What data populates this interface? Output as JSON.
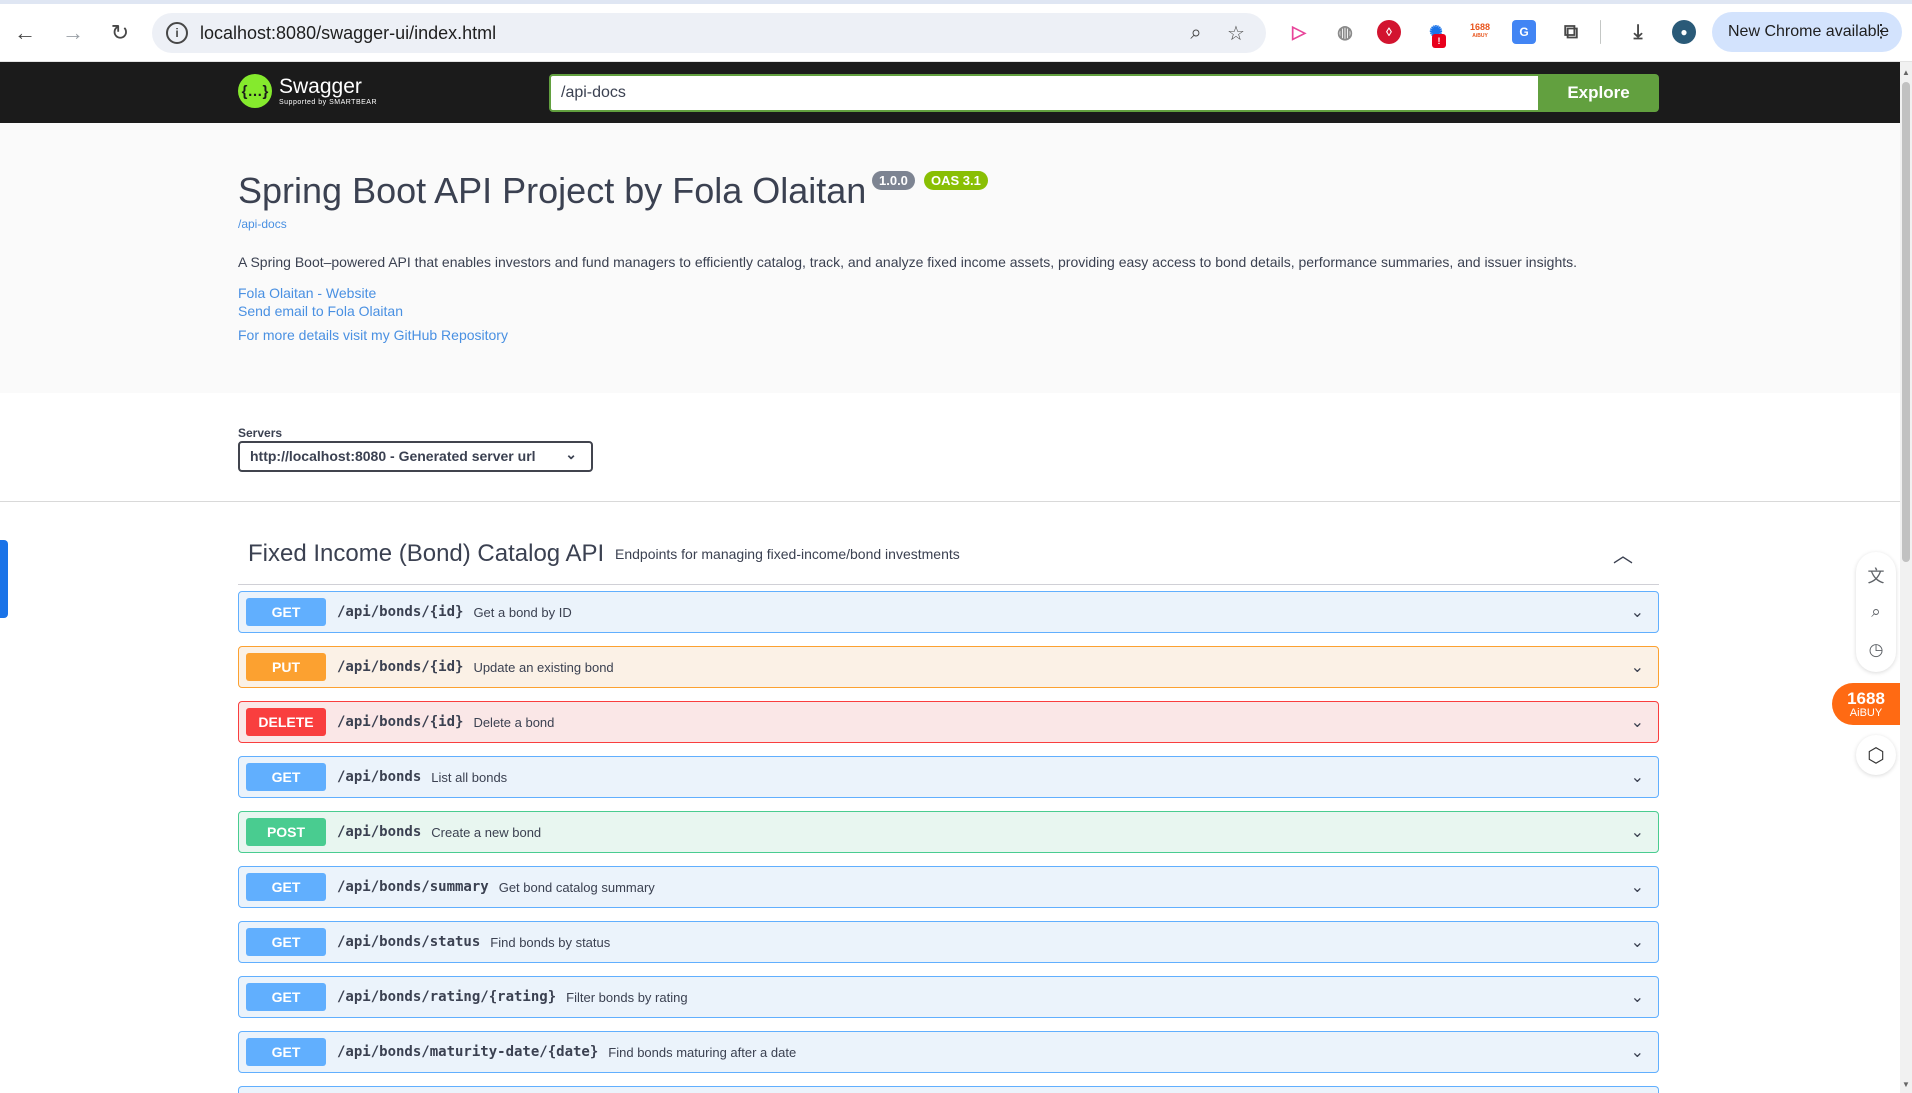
{
  "browser": {
    "url": "localhost:8080/swagger-ui/index.html",
    "new_chrome_label": "New Chrome available",
    "ext_1688": "1688",
    "ext_aibuy_small": "AiBUY"
  },
  "topbar": {
    "logo_text": "Swagger",
    "logo_sub": "Supported by SMARTBEAR",
    "logo_glyph": "{…}",
    "spec_url": "/api-docs",
    "explore_label": "Explore"
  },
  "info": {
    "title": "Spring Boot API Project by Fola Olaitan",
    "version": "1.0.0",
    "oas": "OAS 3.1",
    "spec_link": "/api-docs",
    "description": "A Spring Boot–powered API that enables investors and fund managers to efficiently catalog, track, and analyze fixed income assets, providing easy access to bond details, performance summaries, and issuer insights.",
    "links": {
      "website": "Fola Olaitan - Website",
      "email": "Send email to Fola Olaitan",
      "github": "For more details visit my GitHub Repository"
    }
  },
  "servers": {
    "label": "Servers",
    "selected": "http://localhost:8080 - Generated server url"
  },
  "tag": {
    "name": "Fixed Income (Bond) Catalog API",
    "description": "Endpoints for managing fixed-income/bond investments"
  },
  "operations": [
    {
      "method": "GET",
      "path": "/api/bonds/{id}",
      "summary": "Get a bond by ID"
    },
    {
      "method": "PUT",
      "path": "/api/bonds/{id}",
      "summary": "Update an existing bond"
    },
    {
      "method": "DELETE",
      "path": "/api/bonds/{id}",
      "summary": "Delete a bond"
    },
    {
      "method": "GET",
      "path": "/api/bonds",
      "summary": "List all bonds"
    },
    {
      "method": "POST",
      "path": "/api/bonds",
      "summary": "Create a new bond"
    },
    {
      "method": "GET",
      "path": "/api/bonds/summary",
      "summary": "Get bond catalog summary"
    },
    {
      "method": "GET",
      "path": "/api/bonds/status",
      "summary": "Find bonds by status"
    },
    {
      "method": "GET",
      "path": "/api/bonds/rating/{rating}",
      "summary": "Filter bonds by rating"
    },
    {
      "method": "GET",
      "path": "/api/bonds/maturity-date/{date}",
      "summary": "Find bonds maturing after a date"
    }
  ],
  "floating": {
    "aibuy_num": "1688",
    "aibuy_text": "AiBUY"
  },
  "colors": {
    "get": "#61affe",
    "put": "#fca130",
    "delete": "#f93e3e",
    "post": "#49cc90",
    "swagger_green": "#62a03f",
    "link": "#4990e2"
  }
}
